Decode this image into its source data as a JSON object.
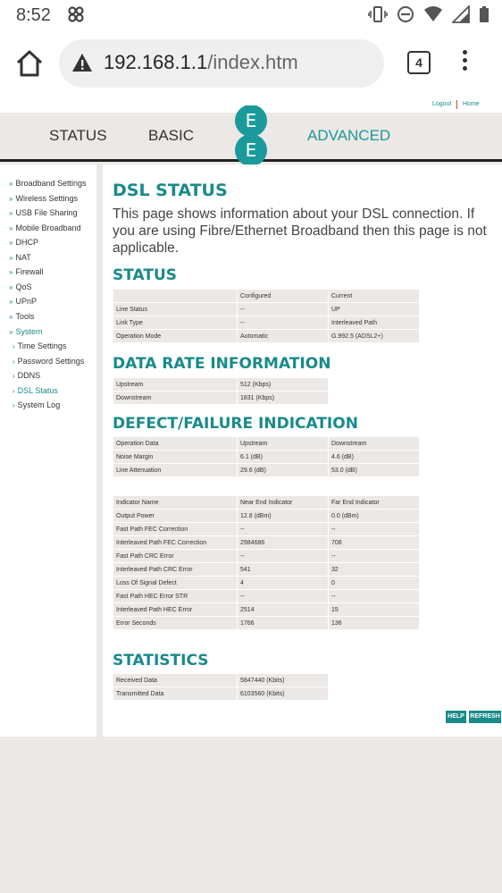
{
  "statusbar": {
    "time": "8:52"
  },
  "browser": {
    "url_host": "192.168.1.1",
    "url_path": "/index.htm",
    "tab_count": "4"
  },
  "toplinks": {
    "logout": "Logout",
    "home": "Home"
  },
  "nav": {
    "status": "STATUS",
    "basic": "BASIC",
    "advanced": "ADVANCED",
    "logo_letters": [
      "E",
      "E"
    ]
  },
  "sidebar": {
    "items": [
      {
        "label": "Broadband Settings"
      },
      {
        "label": "Wireless Settings"
      },
      {
        "label": "USB File Sharing"
      },
      {
        "label": "Mobile Broadband"
      },
      {
        "label": "DHCP"
      },
      {
        "label": "NAT"
      },
      {
        "label": "Firewall"
      },
      {
        "label": "QoS"
      },
      {
        "label": "UPnP"
      },
      {
        "label": "Tools"
      },
      {
        "label": "System"
      },
      {
        "label": "Time Settings"
      },
      {
        "label": "Password Settings"
      },
      {
        "label": "DDNS"
      },
      {
        "label": "DSL Status"
      },
      {
        "label": "System Log"
      }
    ]
  },
  "main": {
    "title": "DSL STATUS",
    "intro": "This page shows information about your DSL connection. If you are using Fibre/Ethernet Broadband then this page is not applicable.",
    "status": {
      "heading": "STATUS",
      "header": [
        "",
        "Configured",
        "Current"
      ],
      "rows": [
        [
          "Line Status",
          "--",
          "UP"
        ],
        [
          "Link Type",
          "--",
          "Interleaved Path"
        ],
        [
          "Operation Mode",
          "Automatic",
          "G.992.5 (ADSL2+)"
        ]
      ]
    },
    "data_rate": {
      "heading": "DATA RATE INFORMATION",
      "rows": [
        [
          "Upstream",
          "512 (Kbps)"
        ],
        [
          "Downstream",
          "1831 (Kbps)"
        ]
      ]
    },
    "defect": {
      "heading": "DEFECT/FAILURE INDICATION",
      "table1": {
        "header": [
          "Operation Data",
          "Upstream",
          "Downstream"
        ],
        "rows": [
          [
            "Noise Margin",
            "6.1 (dB)",
            "4.6 (dB)"
          ],
          [
            "Line Attenuation",
            "29.6 (dB)",
            "53.0 (dB)"
          ]
        ]
      },
      "table2": {
        "header": [
          "Indicator Name",
          "Near End Indicator",
          "Far End Indicator"
        ],
        "rows": [
          [
            "Output Power",
            "12.8 (dBm)",
            "0.0 (dBm)"
          ],
          [
            "Fast Path FEC Correction",
            "--",
            "--"
          ],
          [
            "Interleaved Path FEC Correction",
            "2984686",
            "708"
          ],
          [
            "Fast Path CRC Error",
            "--",
            "--"
          ],
          [
            "Interleaved Path CRC Error",
            "541",
            "32"
          ],
          [
            "Loss Of Signal Defect",
            "4",
            "0"
          ],
          [
            "Fast Path HEC Error STR",
            "--",
            "--"
          ],
          [
            "Interleaved Path HEC Error",
            "2514",
            "15"
          ],
          [
            "Error Seconds",
            "1766",
            "136"
          ]
        ]
      }
    },
    "statistics": {
      "heading": "STATISTICS",
      "rows": [
        [
          "Received Data",
          "5847440 (Kbits)"
        ],
        [
          "Transmitted Data",
          "6103560 (Kbits)"
        ]
      ]
    },
    "buttons": {
      "help": "HELP",
      "refresh": "REFRESH"
    }
  },
  "colors": {
    "accent": "#1a8a8a",
    "cell_bg": "#ebe8e6"
  }
}
